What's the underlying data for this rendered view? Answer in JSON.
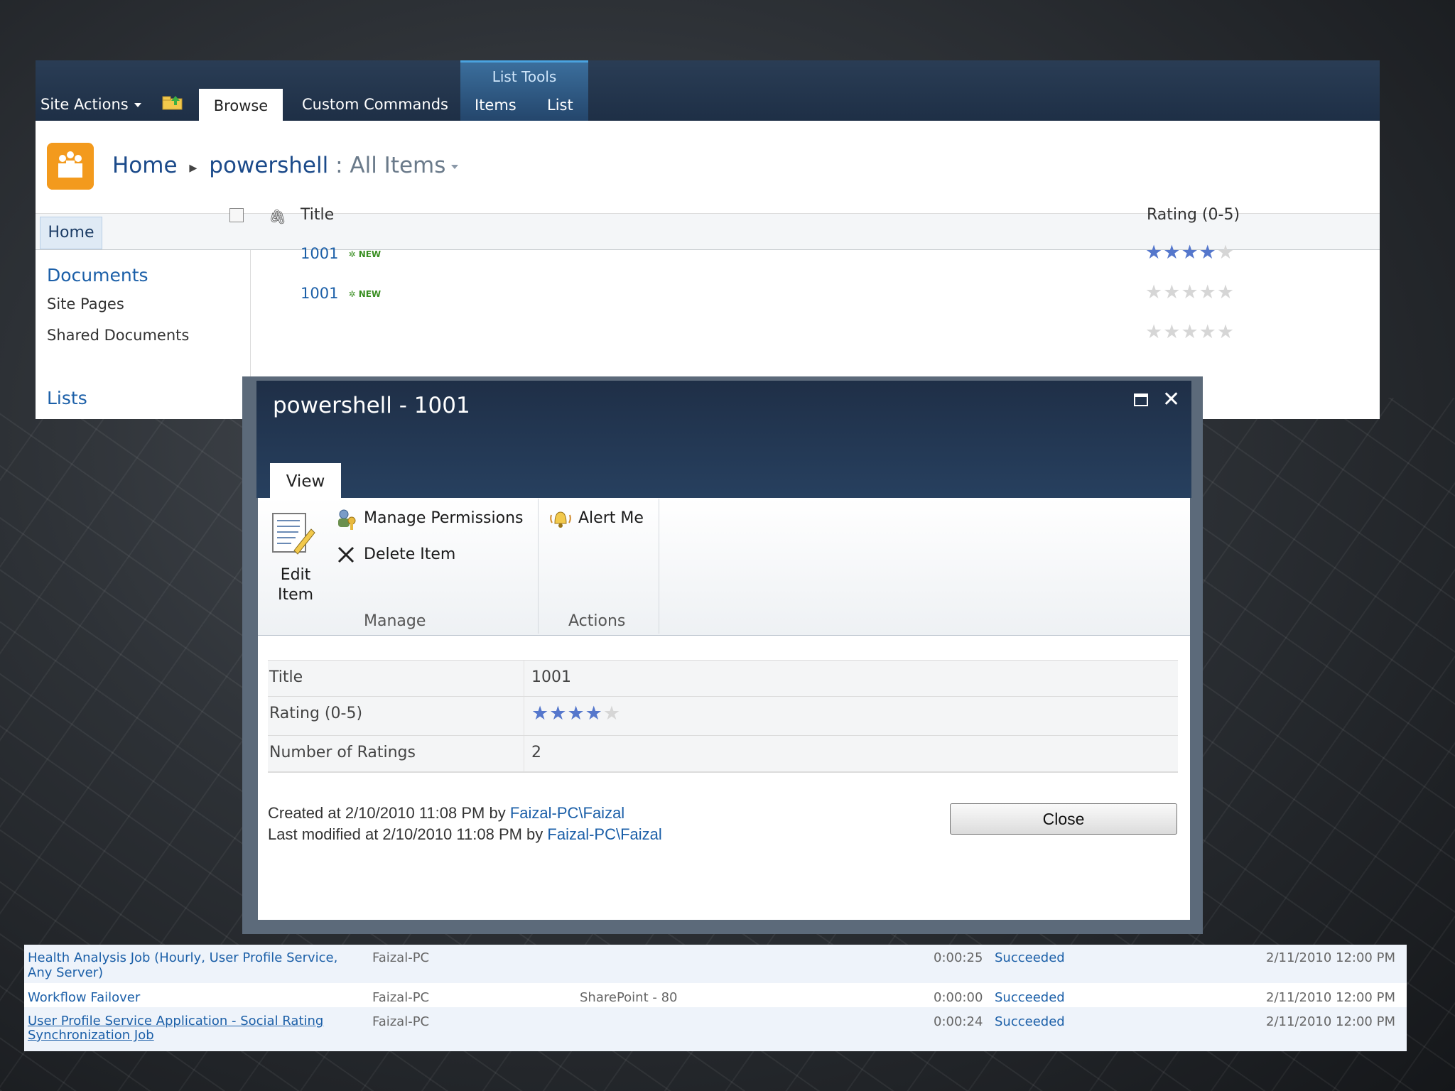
{
  "ribbon": {
    "site_actions": "Site Actions",
    "tab_browse": "Browse",
    "tab_custom_commands": "Custom Commands",
    "list_tools": "List Tools",
    "tab_items": "Items",
    "tab_list": "List"
  },
  "breadcrumb": {
    "home": "Home",
    "list": "powershell",
    "separator": ":",
    "view": "All Items"
  },
  "topnav": {
    "home": "Home"
  },
  "quicklaunch": {
    "documents": "Documents",
    "site_pages": "Site Pages",
    "shared_documents": "Shared Documents",
    "lists": "Lists"
  },
  "list": {
    "col_title": "Title",
    "col_rating": "Rating (0-5)",
    "new_badge": "NEW",
    "items": [
      {
        "title": "1001",
        "rating": 4
      },
      {
        "title": "1001",
        "rating": 0
      }
    ],
    "partial_row_rating": 0
  },
  "dialog": {
    "title": "powershell - 1001",
    "tab_view": "View",
    "edit_item": "Edit Item",
    "edit_item_line1": "Edit",
    "edit_item_line2": "Item",
    "manage_permissions": "Manage Permissions",
    "delete_item": "Delete Item",
    "alert_me": "Alert Me",
    "group_manage": "Manage",
    "group_actions": "Actions",
    "fields": {
      "title_label": "Title",
      "title_value": "1001",
      "rating_label": "Rating (0-5)",
      "rating_value": 4,
      "num_ratings_label": "Number of Ratings",
      "num_ratings_value": "2"
    },
    "created_prefix": "Created at 2/10/2010 11:08 PM by ",
    "created_by": "Faizal-PC\\Faizal",
    "modified_prefix": "Last modified at 2/10/2010 11:08 PM by ",
    "modified_by": "Faizal-PC\\Faizal",
    "close_button": "Close"
  },
  "jobs": [
    {
      "name_line1": "Health Analysis Job (Hourly, User Profile Service,",
      "name_line2": "Any Server)",
      "server": "Faizal-PC",
      "webapp": "",
      "duration": "0:00:25",
      "status": "Succeeded",
      "completed": "2/11/2010 12:00 PM"
    },
    {
      "name_line1": "Workflow Failover",
      "name_line2": "",
      "server": "Faizal-PC",
      "webapp": "SharePoint - 80",
      "duration": "0:00:00",
      "status": "Succeeded",
      "completed": "2/11/2010 12:00 PM"
    },
    {
      "name_line1": "User Profile Service Application - Social Rating",
      "name_line2": "Synchronization Job",
      "server": "Faizal-PC",
      "webapp": "",
      "duration": "0:00:24",
      "status": "Succeeded",
      "completed": "2/11/2010 12:00 PM"
    }
  ],
  "colors": {
    "link": "#1b5fa8",
    "ribbon": "#1e2f46",
    "star_on": "#5577cc",
    "new_badge": "#3a8f22"
  }
}
